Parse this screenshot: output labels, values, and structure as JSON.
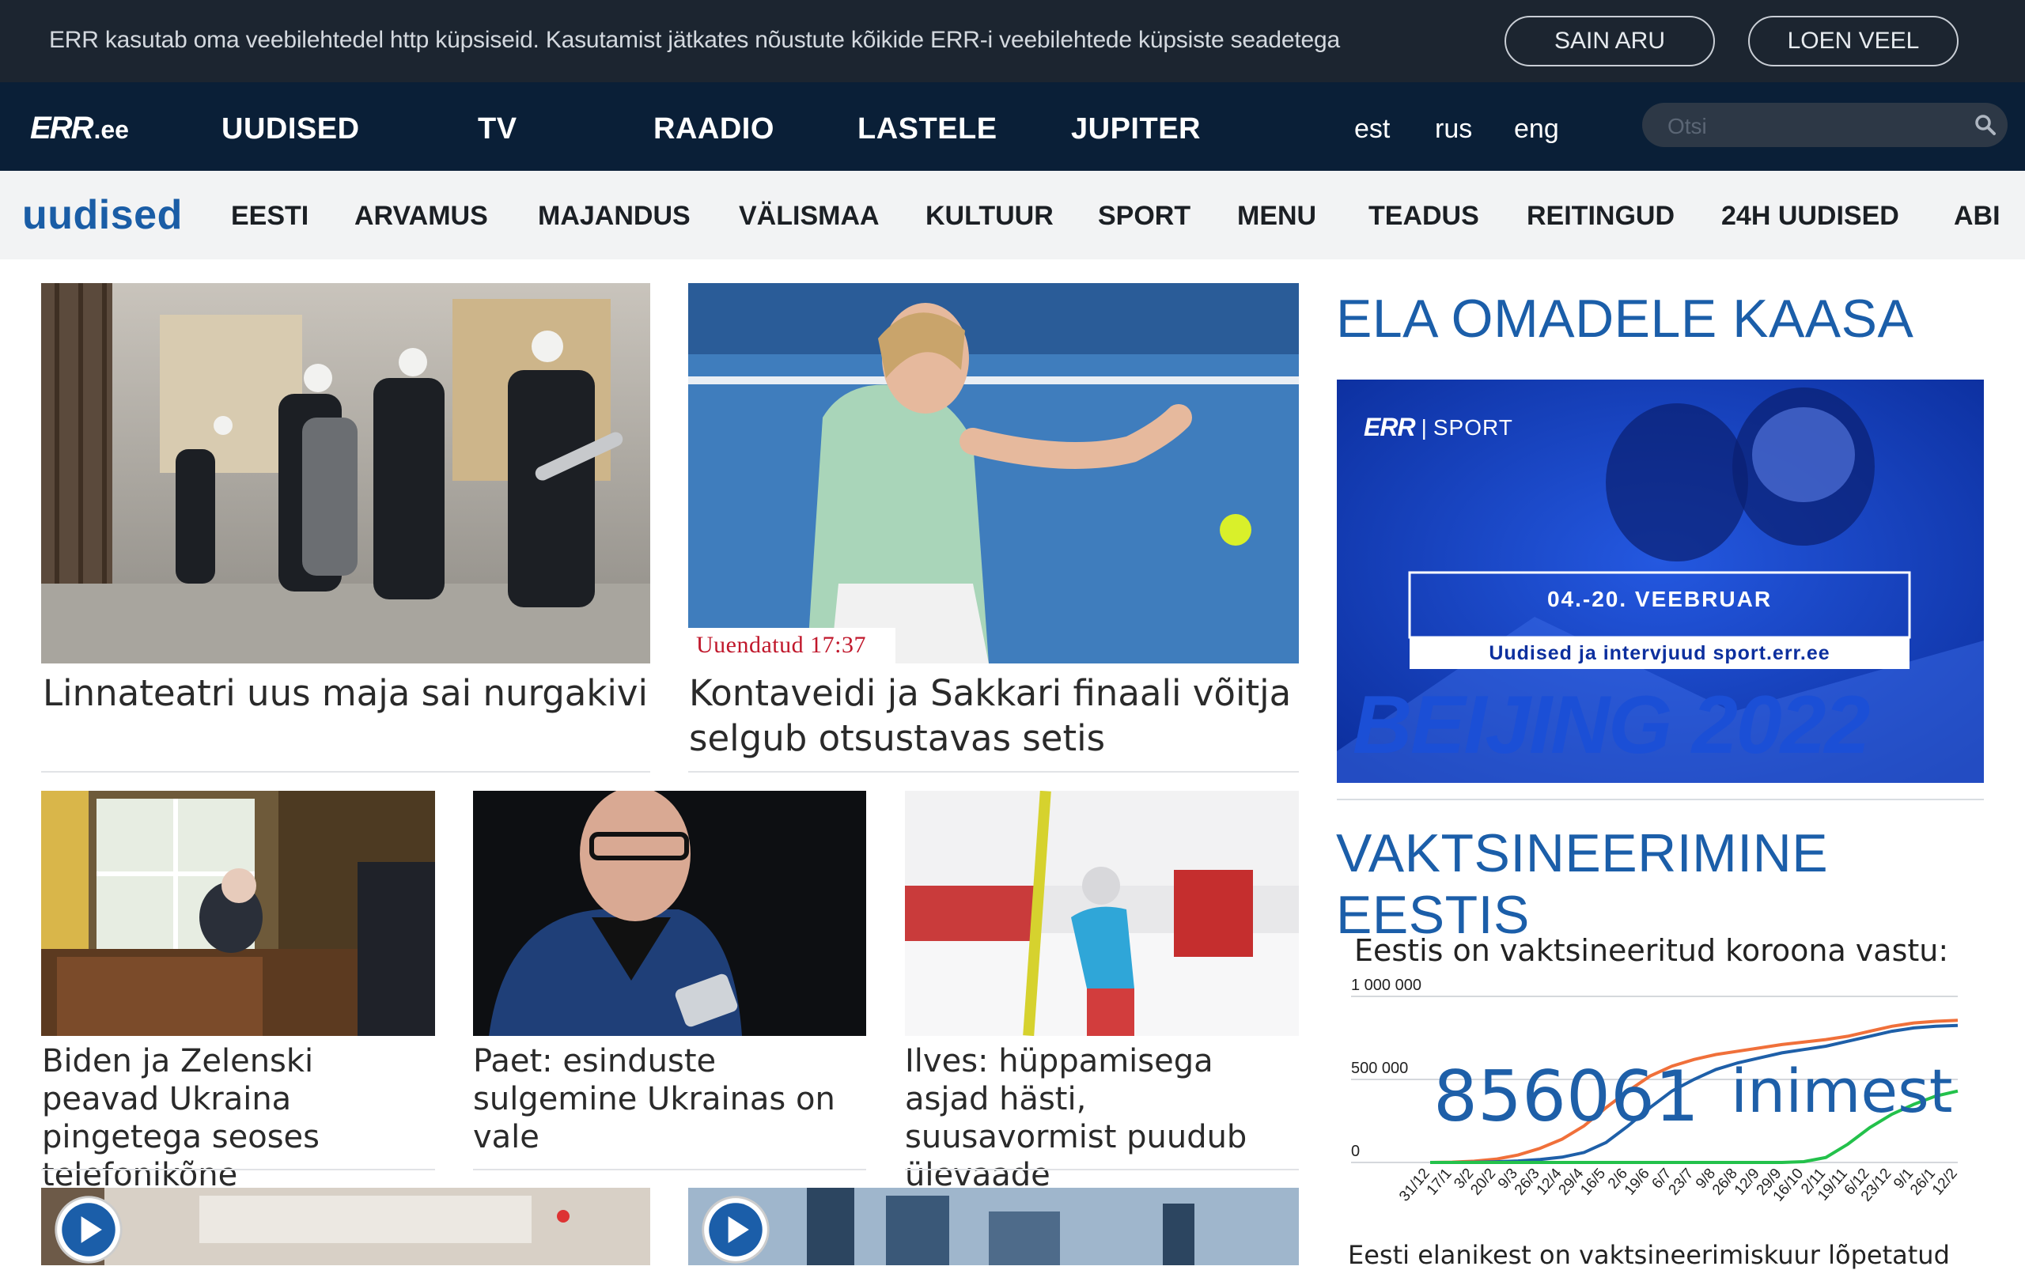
{
  "cookie": {
    "text": "ERR kasutab oma veebilehtedel http küpsiseid. Kasutamist jätkates nõustute kõikide ERR-i veebilehtede küpsiste seadetega",
    "accept_label": "SAIN ARU",
    "more_label": "LOEN VEEL"
  },
  "header": {
    "logo_main": "ERR",
    "logo_suffix": ".ee",
    "nav": [
      "UUDISED",
      "TV",
      "RAADIO",
      "LASTELE",
      "JUPITER"
    ],
    "langs": [
      "est",
      "rus",
      "eng"
    ],
    "search_placeholder": "Otsi"
  },
  "subnav": {
    "brand": "uudised",
    "items": [
      "EESTI",
      "ARVAMUS",
      "MAJANDUS",
      "VÄLISMAA",
      "KULTUUR",
      "SPORT",
      "MENU",
      "TEADUS",
      "REITINGUD",
      "24H UUDISED",
      "ABI"
    ]
  },
  "articles": {
    "a1": "Linnateatri uus maja sai nurgakivi",
    "a2": "Kontaveidi ja Sakkari finaali võitja selgub otsustavas setis",
    "a2_updated": "Uuendatud 17:37",
    "a3": "Biden ja Zelenski peavad Ukraina pingetega seoses telefonikõne",
    "a4": "Paet: esinduste sulgemine Ukrainas on vale",
    "a5": "Ilves: hüppamisega asjad hästi, suusavormist puudub ülevaade"
  },
  "sidebar": {
    "promo_title": "ELA OMADELE KAASA",
    "banner": {
      "brand": "ERR",
      "brand_section": "SPORT",
      "dates": "04.-20. VEEBRUAR",
      "subtitle": "Uudised ja intervjuud sport.err.ee",
      "event": "BEIJING 2022"
    },
    "vacc_title": "VAKTSINEERIMINE EESTIS",
    "vacc_sub": "Eestis on vaktsineeritud koroona vastu:",
    "vacc_count": "856061",
    "vacc_unit": "inimest",
    "vacc_foot": "Eesti elanikest on vaktsineerimiskuur lõpetatud"
  },
  "colors": {
    "accent": "#1b5ea9",
    "nav_bg": "#0a1f37",
    "cookie_bg": "#1c2530",
    "updated": "#c0172b"
  },
  "chart_data": {
    "type": "line",
    "title": "",
    "x": [
      "31/12",
      "17/1",
      "3/2",
      "20/2",
      "9/3",
      "26/3",
      "12/4",
      "29/4",
      "16/5",
      "2/6",
      "19/6",
      "6/7",
      "23/7",
      "9/8",
      "26/8",
      "12/9",
      "29/9",
      "16/10",
      "2/11",
      "19/11",
      "6/12",
      "23/12",
      "9/1",
      "26/1",
      "12/2"
    ],
    "yticks": [
      "1 000 000",
      "500 000",
      "0"
    ],
    "ylim": [
      0,
      1000000
    ],
    "series": [
      {
        "color": "#f0703a",
        "values": [
          0,
          2000,
          8000,
          20000,
          45000,
          85000,
          140000,
          220000,
          330000,
          430000,
          520000,
          580000,
          620000,
          650000,
          670000,
          690000,
          710000,
          725000,
          740000,
          760000,
          790000,
          820000,
          840000,
          850000,
          856000
        ]
      },
      {
        "color": "#1e5fa8",
        "values": [
          0,
          0,
          1000,
          4000,
          9000,
          18000,
          32000,
          60000,
          120000,
          220000,
          330000,
          430000,
          500000,
          560000,
          600000,
          630000,
          660000,
          680000,
          700000,
          730000,
          760000,
          790000,
          810000,
          820000,
          825000
        ]
      },
      {
        "color": "#23c14b",
        "values": [
          0,
          0,
          0,
          0,
          0,
          0,
          0,
          0,
          0,
          0,
          0,
          0,
          0,
          0,
          0,
          0,
          0,
          5000,
          30000,
          110000,
          210000,
          290000,
          350000,
          400000,
          430000
        ]
      }
    ]
  }
}
